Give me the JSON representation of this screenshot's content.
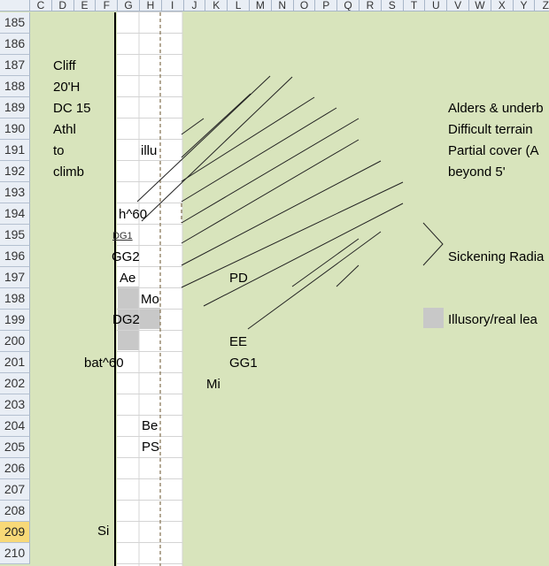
{
  "columns": [
    "C",
    "D",
    "E",
    "F",
    "G",
    "H",
    "I",
    "J",
    "K",
    "L",
    "M",
    "N",
    "O",
    "P",
    "Q",
    "R",
    "S",
    "T",
    "U",
    "V",
    "W",
    "X",
    "Y",
    "Z"
  ],
  "rows": [
    "185",
    "186",
    "187",
    "188",
    "189",
    "190",
    "191",
    "192",
    "193",
    "194",
    "195",
    "196",
    "197",
    "198",
    "199",
    "200",
    "201",
    "202",
    "203",
    "204",
    "205",
    "206",
    "207",
    "208",
    "209",
    "210"
  ],
  "selected_row": "209",
  "cells": {
    "cliff": "Cliff",
    "height": "20'H",
    "dc": "DC 15",
    "athl": "Athl",
    "to": "to",
    "climb": "climb",
    "illu": "illu",
    "h60": "h^60",
    "dg1": "DG1",
    "gg2": "GG2",
    "ae": "Ae",
    "mo": "Mo",
    "dg2": "DG2",
    "bat60": "bat^60",
    "be": "Be",
    "ps": "PS",
    "si": "Si",
    "pd": "PD",
    "ee": "EE",
    "gg1": "GG1",
    "mi": "Mi"
  },
  "notes": {
    "alders": "Alders & underb",
    "difficult": "Difficult terrain",
    "partial": "Partial cover (A",
    "beyond": "beyond 5'",
    "sickening": "Sickening Radia",
    "illusory": "Illusory/real lea"
  },
  "colors": {
    "sheet_bg": "#d8e4bc",
    "header_bg": "#e9eef5",
    "selected_row_header": "#f8d978",
    "gray_fill": "#c8c8c8"
  }
}
